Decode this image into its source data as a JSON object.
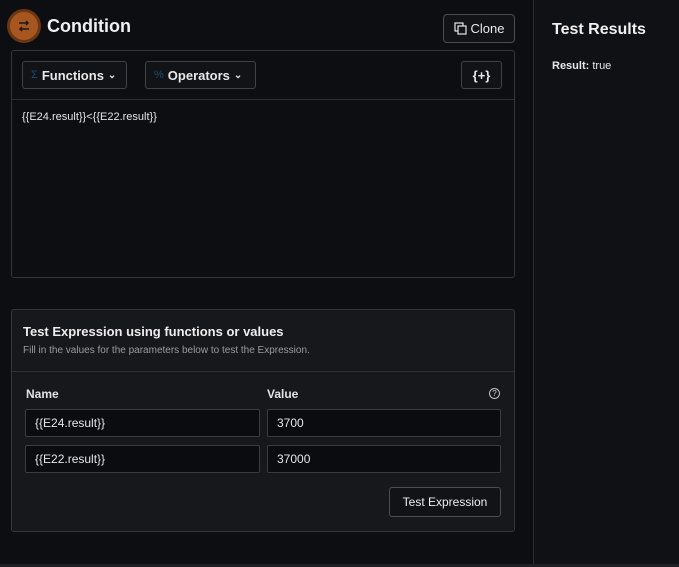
{
  "header": {
    "title": "Condition",
    "icon": "swap-arrows-icon",
    "clone_label": "Clone"
  },
  "editor": {
    "functions_label": "Functions",
    "functions_symbol": "Σ",
    "operators_label": "Operators",
    "operators_symbol": "%",
    "insert_var_label": "{+}",
    "expression": "{{E24.result}}<{{E22.result}}"
  },
  "test_panel": {
    "title": "Test Expression using functions or values",
    "subtitle": "Fill in the values for the parameters below to test the Expression.",
    "name_header": "Name",
    "value_header": "Value",
    "rows": [
      {
        "name": "{{E24.result}}",
        "value": "3700"
      },
      {
        "name": "{{E22.result}}",
        "value": "37000"
      }
    ],
    "test_button_label": "Test Expression"
  },
  "results": {
    "title": "Test Results",
    "result_label": "Result:",
    "result_value": "true"
  },
  "colors": {
    "accent": "#a8561f",
    "background": "#0d0e11",
    "panel": "#17181c"
  }
}
